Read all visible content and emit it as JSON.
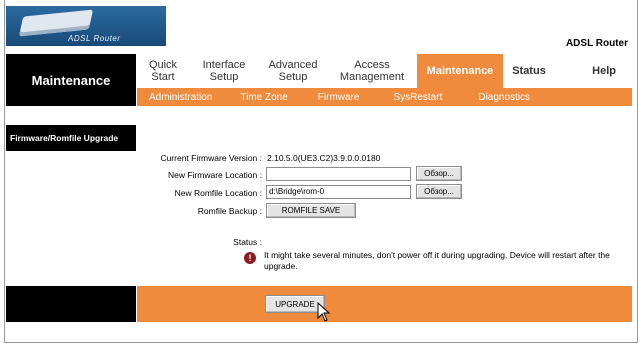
{
  "brand": {
    "logo_text": "ADSL Router",
    "product_name": "ADSL Router"
  },
  "section_title": "Maintenance",
  "menu": [
    {
      "label": "Quick Start",
      "active": false
    },
    {
      "label": "Interface Setup",
      "active": false
    },
    {
      "label": "Advanced Setup",
      "active": false
    },
    {
      "label": "Access Management",
      "active": false
    },
    {
      "label": "Maintenance",
      "active": true
    },
    {
      "label": "Status",
      "active": false
    },
    {
      "label": "Help",
      "active": false
    }
  ],
  "submenu": [
    "Administration",
    "Time Zone",
    "Firmware",
    "SysRestart",
    "Diagnostics"
  ],
  "page_header": "Firmware/Romfile Upgrade",
  "form": {
    "current_fw_label": "Current Firmware Version :",
    "current_fw_value": "2.10.5.0(UE3.C2)3.9.0.0.0180",
    "new_fw_label": "New Firmware Location :",
    "new_fw_value": "",
    "new_rom_label": "New Romfile Location :",
    "new_rom_value": "d:\\Bridge\\rom-0",
    "browse_label": "Обзор...",
    "rom_backup_label": "Romfile Backup :",
    "rom_save_button": "ROMFILE SAVE",
    "status_label": "Status :",
    "status_message": "It might take several minutes, don't power off it during upgrading. Device will restart after the upgrade."
  },
  "footer": {
    "upgrade_button": "UPGRADE"
  },
  "colors": {
    "accent": "#f08a3c",
    "header_black": "#000000",
    "warning": "#8e1b22"
  }
}
